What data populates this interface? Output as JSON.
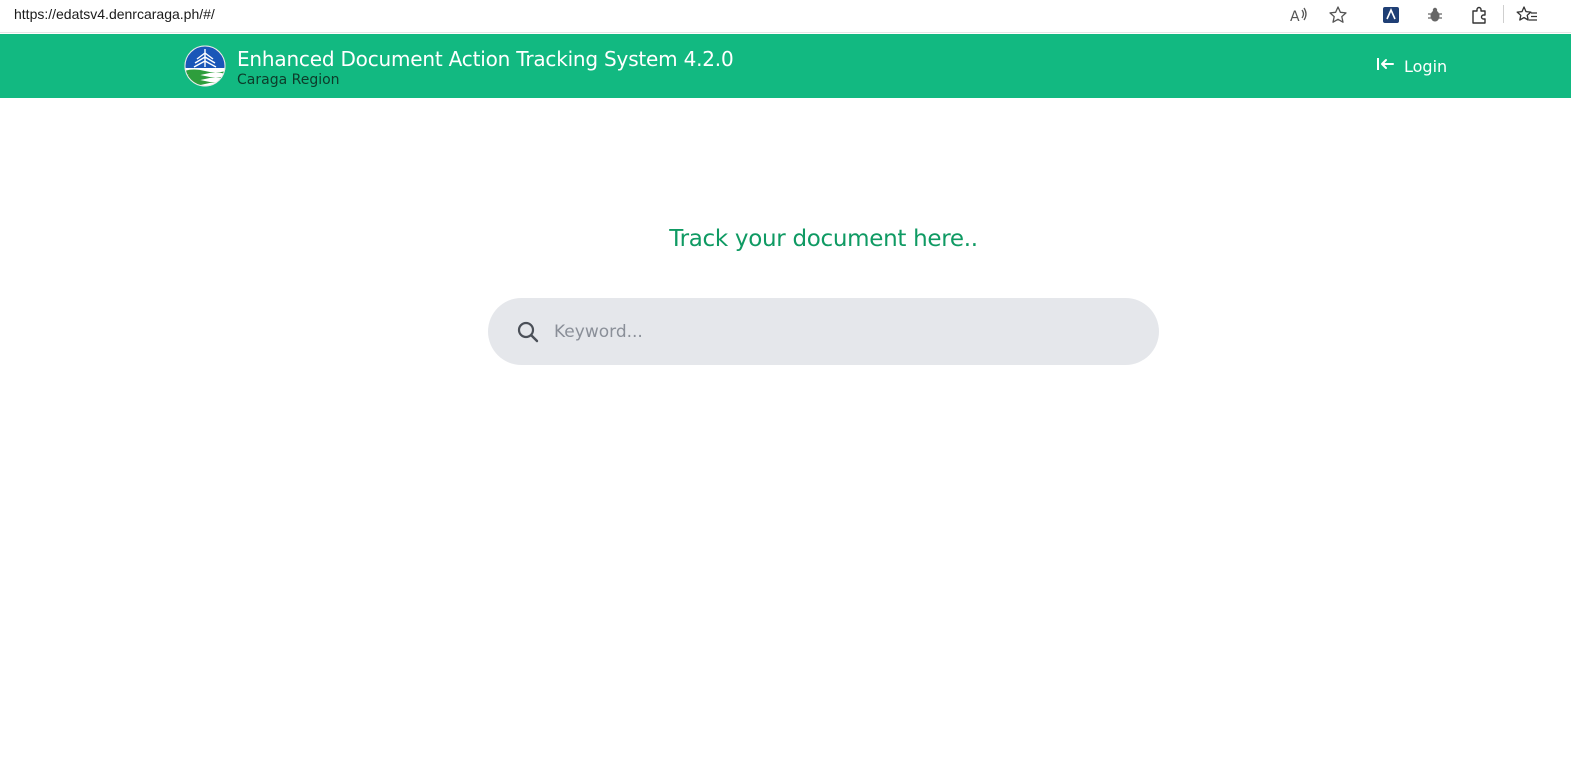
{
  "browser": {
    "url": "https://edatsv4.denrcaraga.ph/#/",
    "icons": [
      "read-aloud-icon",
      "favorite-star-icon",
      "extension-icon",
      "bug-icon",
      "puzzle-icon",
      "favorites-icon"
    ]
  },
  "header": {
    "title": "Enhanced Document Action Tracking System 4.2.0",
    "subtitle": "Caraga Region",
    "login_label": "Login",
    "background_color": "#12b981"
  },
  "main": {
    "heading": "Track your document here..",
    "heading_color": "#0f9a63",
    "search": {
      "placeholder": "Keyword...",
      "value": ""
    }
  }
}
